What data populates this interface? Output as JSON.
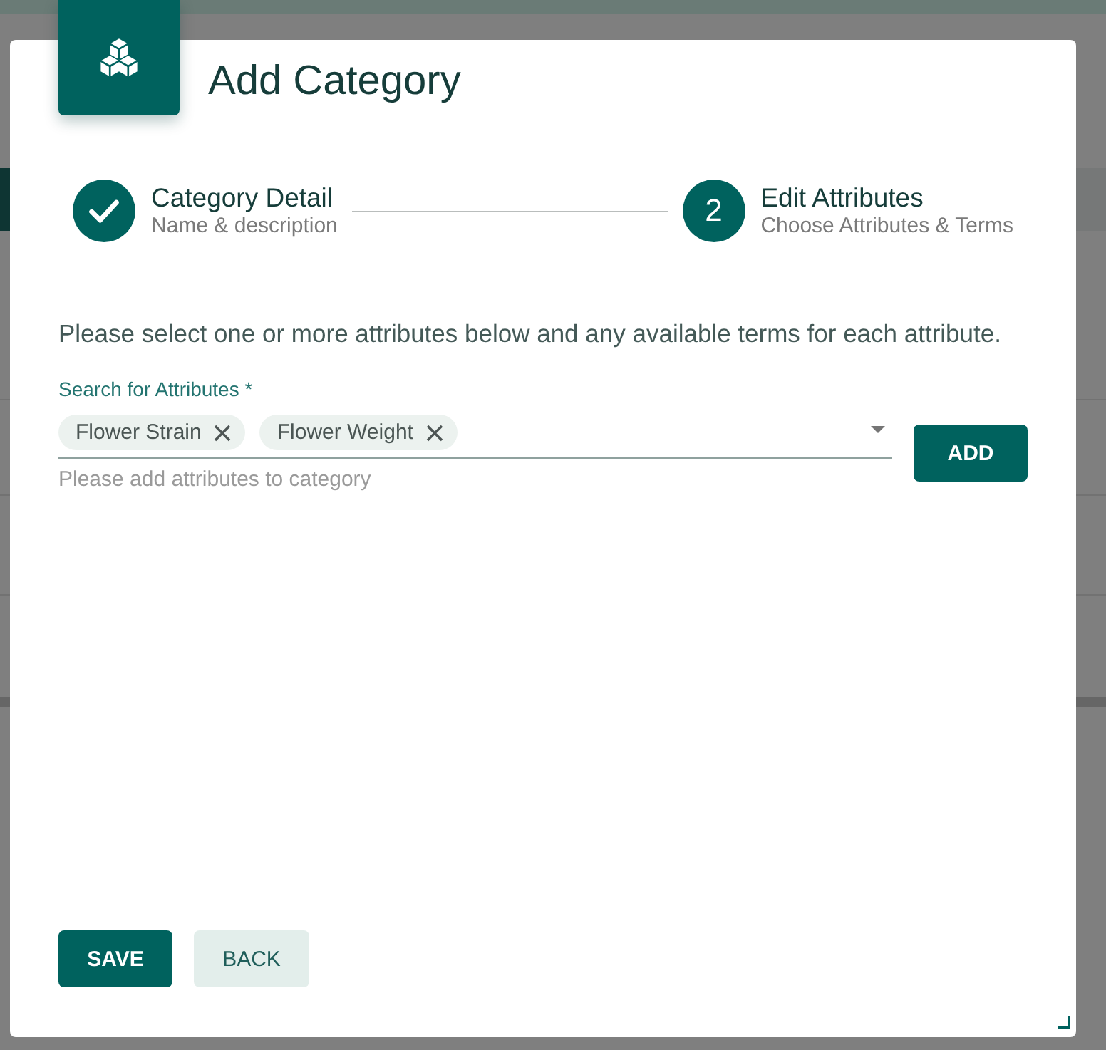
{
  "dialog": {
    "title": "Add Category"
  },
  "stepper": [
    {
      "completed": true,
      "title": "Category Detail",
      "subtitle": "Name & description"
    },
    {
      "completed": false,
      "number": "2",
      "title": "Edit Attributes",
      "subtitle": "Choose Attributes & Terms"
    }
  ],
  "instructions": "Please select one or more attributes below and any available terms for each attribute.",
  "attribute_search": {
    "label": "Search for Attributes *",
    "chips": [
      {
        "label": "Flower Strain"
      },
      {
        "label": "Flower Weight"
      }
    ],
    "hint": "Please add attributes to category",
    "add_button": "ADD"
  },
  "footer": {
    "buttons": [
      {
        "kind": "primary",
        "label": "SAVE"
      },
      {
        "kind": "secondary",
        "label": "BACK"
      }
    ]
  }
}
